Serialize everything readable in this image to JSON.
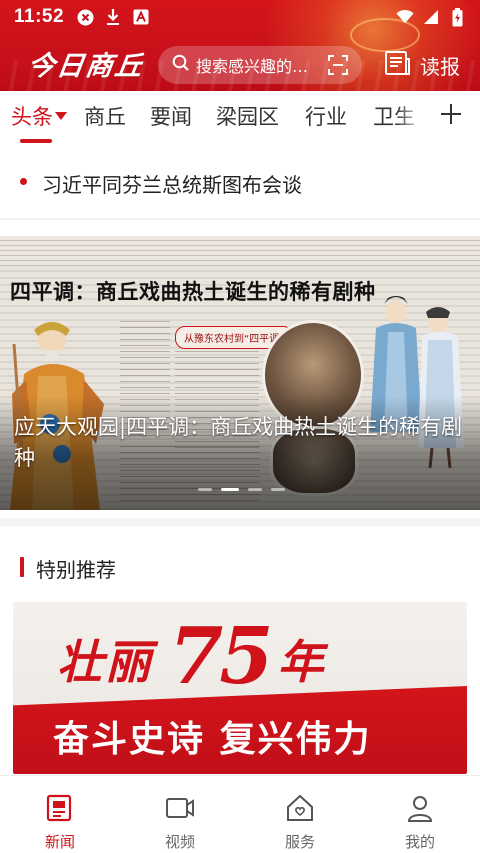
{
  "status_bar": {
    "time": "11:52",
    "icons": [
      "close-circle-icon",
      "download-icon",
      "text-a-icon",
      "wifi-icon",
      "signal-icon",
      "battery-icon"
    ]
  },
  "header": {
    "logo": "今日商丘",
    "search_placeholder": "搜索感兴趣的…",
    "read_label": "读报",
    "accent_color": "#d0121b"
  },
  "tabs": [
    {
      "label": "头条",
      "active": true
    },
    {
      "label": "商丘",
      "active": false
    },
    {
      "label": "要闻",
      "active": false
    },
    {
      "label": "梁园区",
      "active": false
    },
    {
      "label": "行业",
      "active": false
    },
    {
      "label": "卫生",
      "active": false
    }
  ],
  "headline": {
    "text": "习近平同芬兰总统斯图布会谈"
  },
  "banner": {
    "image_headline": "四平调：商丘戏曲热土诞生的稀有剧种",
    "caption": "应天大观园|四平调：商丘戏曲热土诞生的稀有剧种",
    "tag": "从豫东农村到“四平调”",
    "pager": {
      "count": 4,
      "active_index": 1
    }
  },
  "special": {
    "title": "特别推荐",
    "promo_line1_a": "壮丽",
    "promo_number": "75",
    "promo_line1_b": "年",
    "promo_line2": "奋斗史诗 复兴伟力"
  },
  "bottom_nav": [
    {
      "label": "新闻",
      "icon": "news-icon",
      "active": true
    },
    {
      "label": "视频",
      "icon": "video-icon",
      "active": false
    },
    {
      "label": "服务",
      "icon": "service-home-icon",
      "active": false
    },
    {
      "label": "我的",
      "icon": "profile-icon",
      "active": false
    }
  ]
}
